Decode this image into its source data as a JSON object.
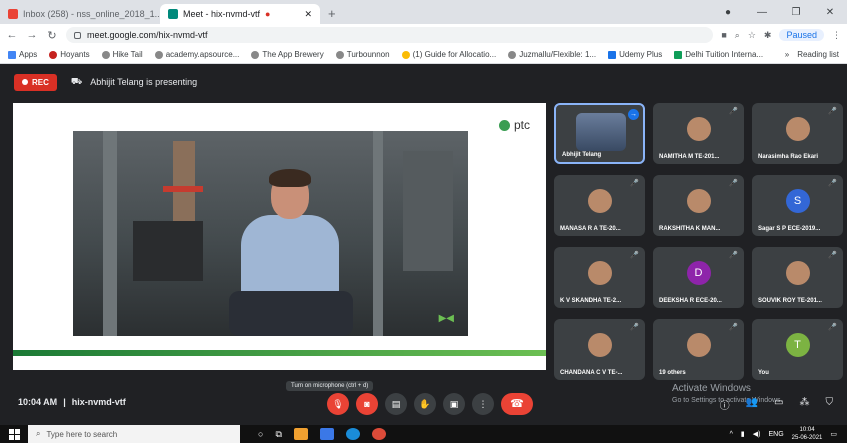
{
  "browser": {
    "tabs": [
      {
        "label": "Inbox (258) - nss_online_2018_1...",
        "fav_color": "#ea4335",
        "active": false
      },
      {
        "label": "Meet - hix-nvmd-vtf",
        "fav_color": "#00897b",
        "active": true
      }
    ],
    "url": "meet.google.com/hix-nvmd-vtf",
    "profile_label": "Paused",
    "bookmarks": [
      "Apps",
      "Hoyants",
      "Hike Tail",
      "academy.apsource...",
      "The App Brewery",
      "Turbounnon",
      "(1) Guide for Allocatio...",
      "Juzmallu/Flexible: 1...",
      "Udemy Plus",
      "Delhi Tuition Interna..."
    ],
    "bookmarks_right": [
      "Reading list"
    ]
  },
  "meet": {
    "rec_label": "REC",
    "presenting_text": "Abhijit Telang is presenting",
    "slide_logo": "ptc",
    "participants": [
      {
        "name": "Abhijit Telang",
        "initial": "",
        "color": "",
        "active": true
      },
      {
        "name": "NAMITHA M TE-201...",
        "initial": "",
        "color": "",
        "active": false
      },
      {
        "name": "Narasimha Rao Ekari",
        "initial": "",
        "color": "",
        "active": false
      },
      {
        "name": "MANASA R A TE-20...",
        "initial": "",
        "color": "",
        "active": false
      },
      {
        "name": "RAKSHITHA K MAN...",
        "initial": "",
        "color": "",
        "active": false
      },
      {
        "name": "Sagar S P ECE-2019...",
        "initial": "S",
        "color": "#3367d6",
        "active": false
      },
      {
        "name": "K V SKANDHA TE-2...",
        "initial": "",
        "color": "",
        "active": false
      },
      {
        "name": "DEEKSHA R ECE-20...",
        "initial": "D",
        "color": "#8e24aa",
        "active": false
      },
      {
        "name": "SOUVIK ROY TE-201...",
        "initial": "",
        "color": "",
        "active": false
      },
      {
        "name": "CHANDANA C V TE-...",
        "initial": "",
        "color": "",
        "active": false
      },
      {
        "name": "19 others",
        "initial": "",
        "color": "",
        "active": false
      },
      {
        "name": "You",
        "initial": "T",
        "color": "#7cb342",
        "active": false
      }
    ],
    "time": "10:04 AM",
    "meeting_code": "hix-nvmd-vtf",
    "tooltip": "Turn on microphone (ctrl + d)",
    "activate_title": "Activate Windows",
    "activate_sub": "Go to Settings to activate Windows."
  },
  "taskbar": {
    "search_placeholder": "Type here to search",
    "lang": "ENG",
    "time": "10:04",
    "date": "25-06-2021"
  }
}
